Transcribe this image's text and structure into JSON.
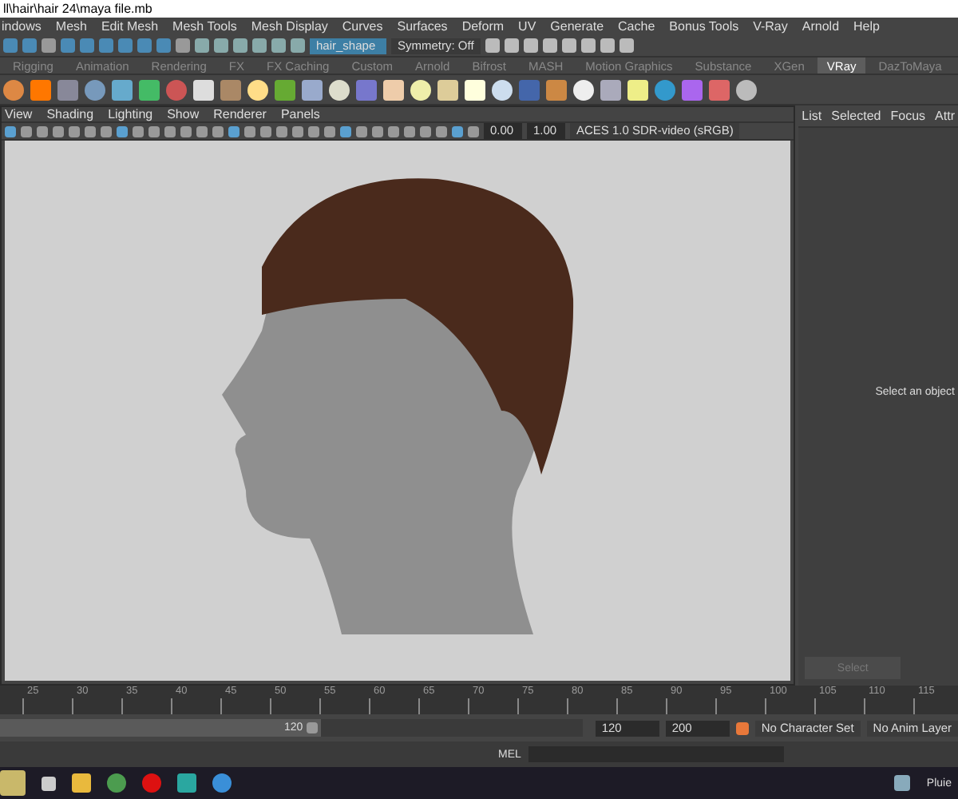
{
  "window": {
    "title": "ll\\hair\\hair 24\\maya file.mb"
  },
  "menu_bar": [
    "indows",
    "Mesh",
    "Edit Mesh",
    "Mesh Tools",
    "Mesh Display",
    "Curves",
    "Surfaces",
    "Deform",
    "UV",
    "Generate",
    "Cache",
    "Bonus Tools",
    "V-Ray",
    "Arnold",
    "Help"
  ],
  "status_line": {
    "object_field": {
      "value": "hair_shape"
    },
    "symmetry": "Symmetry: Off"
  },
  "shelf_tabs": [
    {
      "label": "Rigging",
      "selected": false
    },
    {
      "label": "Animation",
      "selected": false
    },
    {
      "label": "Rendering",
      "selected": false
    },
    {
      "label": "FX",
      "selected": false
    },
    {
      "label": "FX Caching",
      "selected": false
    },
    {
      "label": "Custom",
      "selected": false
    },
    {
      "label": "Arnold",
      "selected": false
    },
    {
      "label": "Bifrost",
      "selected": false
    },
    {
      "label": "MASH",
      "selected": false
    },
    {
      "label": "Motion Graphics",
      "selected": false
    },
    {
      "label": "Substance",
      "selected": false
    },
    {
      "label": "XGen",
      "selected": false
    },
    {
      "label": "VRay",
      "selected": true
    },
    {
      "label": "DazToMaya",
      "selected": false
    }
  ],
  "viewport": {
    "menus": [
      "View",
      "Shading",
      "Lighting",
      "Show",
      "Renderer",
      "Panels"
    ],
    "exposure": "0.00",
    "gamma": "1.00",
    "color_space": "ACES 1.0 SDR-video (sRGB)"
  },
  "attribute_panel": {
    "tabs": [
      "List",
      "Selected",
      "Focus",
      "Attr"
    ],
    "message": "Select an object",
    "button": "Select"
  },
  "timeline": {
    "ticks": [
      "25",
      "30",
      "35",
      "40",
      "45",
      "50",
      "55",
      "60",
      "65",
      "70",
      "75",
      "80",
      "85",
      "90",
      "95",
      "100",
      "105",
      "110",
      "115"
    ]
  },
  "range_slider": {
    "level": 0.55,
    "range_end": "120",
    "playback_end": "120",
    "animation_end": "200",
    "character_set": "No Character Set",
    "anim_layer": "No Anim Layer"
  },
  "command_line": {
    "language": "MEL"
  },
  "taskbar": {
    "weather": "Pluie"
  }
}
